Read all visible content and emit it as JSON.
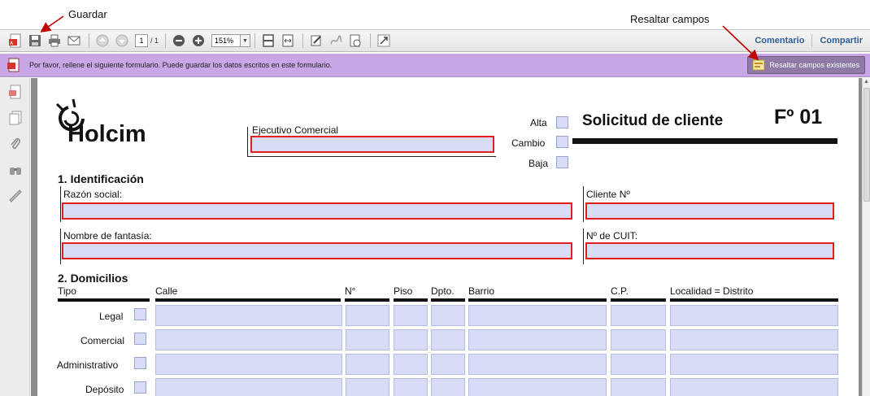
{
  "annotations": {
    "guardar": "Guardar",
    "resaltar": "Resaltar campos"
  },
  "toolbar": {
    "page_current": "1",
    "page_total": "/ 1",
    "zoom": "151%",
    "comment_label": "Comentario",
    "share_label": "Compartir"
  },
  "message_bar": {
    "text": "Por favor, rellene el siguiente formulario. Puede guardar los datos escritos en este formulario.",
    "highlight_button": "Resaltar campos existentes"
  },
  "form": {
    "logo_text": "Holcim",
    "ejecutivo_label": "Ejecutivo Comercial",
    "alta": "Alta",
    "cambio": "Cambio",
    "baja": "Baja",
    "title": "Solicitud de cliente",
    "form_number": "Fº 01",
    "section1": "1. Identificación",
    "razon_social": "Razón social:",
    "cliente_no": "Cliente Nº",
    "nombre_fantasia": "Nombre de fantasía:",
    "cuit": "Nº de CUIT:",
    "section2": "2. Domicilios",
    "columns": [
      "Tipo",
      "Calle",
      "N°",
      "Piso",
      "Dpto.",
      "Barrio",
      "C.P.",
      "Localidad = Distrito"
    ],
    "rows": [
      "Legal",
      "Comercial",
      "Administrativo",
      "Depósito"
    ]
  },
  "colors": {
    "field_fill": "#d8dcf6",
    "required_border": "#e02020",
    "message_bar": "#c9a6e6",
    "link_blue": "#2e5d94"
  }
}
